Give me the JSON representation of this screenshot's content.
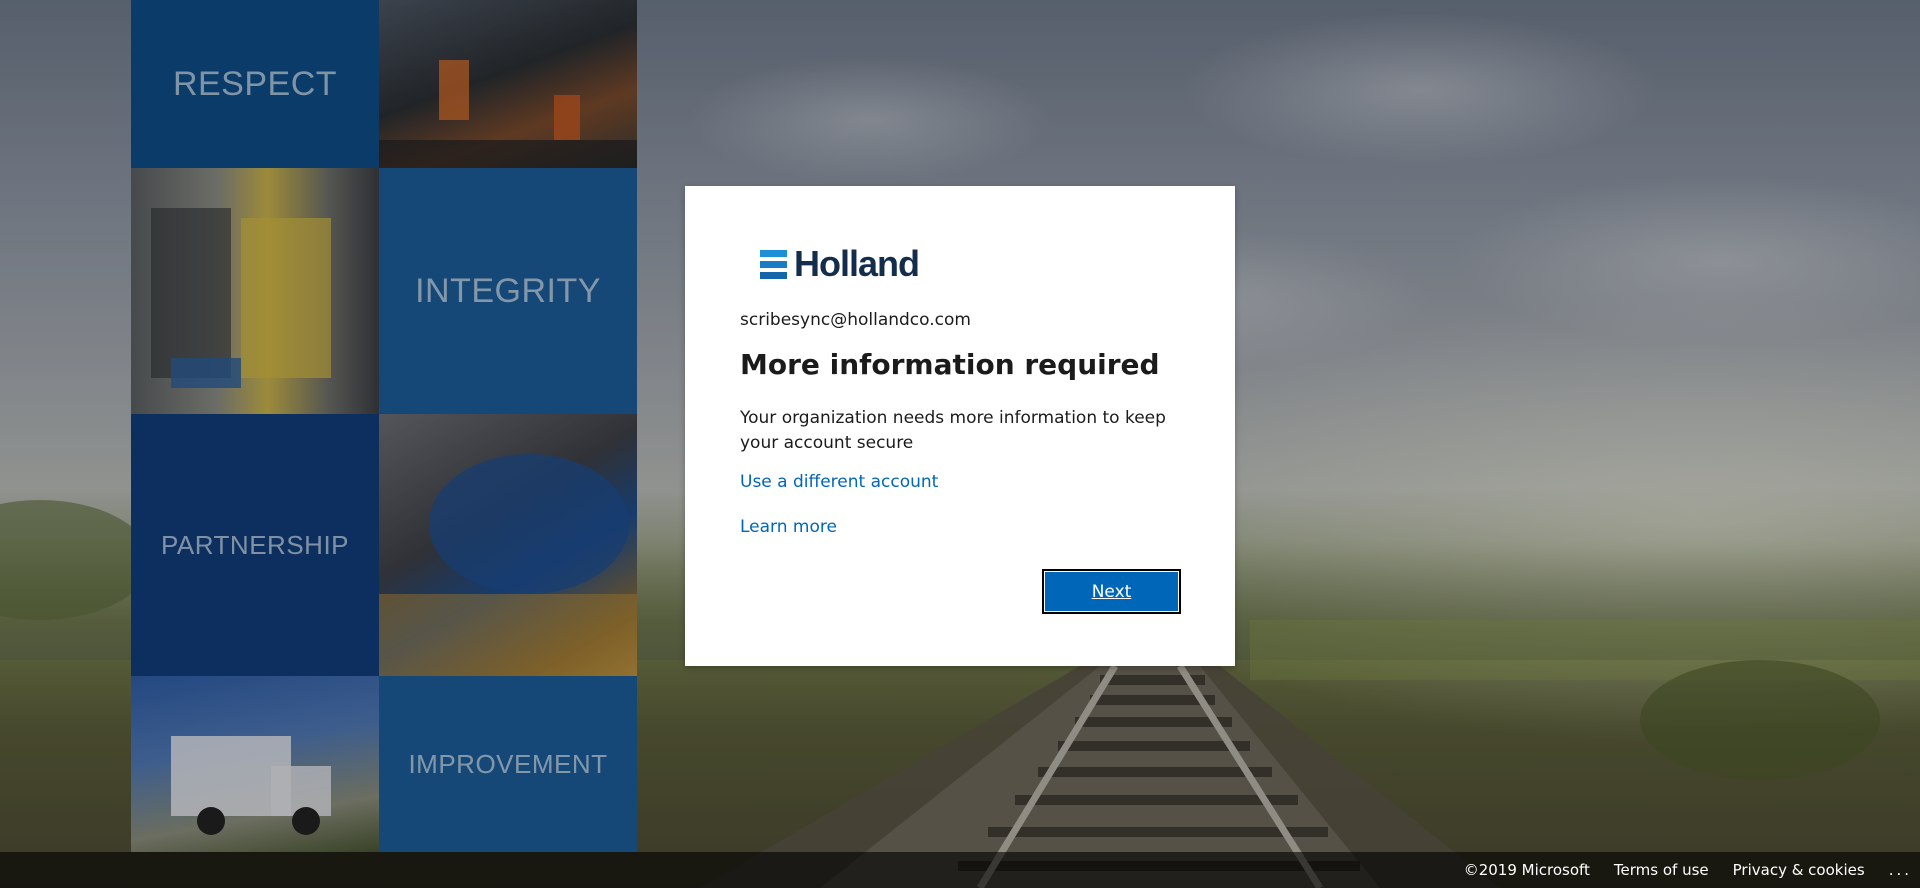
{
  "background": {
    "values_tiles": [
      {
        "label": "RESPECT"
      },
      {
        "label": "INTEGRITY"
      },
      {
        "label": "PARTNERSHIP"
      },
      {
        "label": "IMPROVEMENT"
      }
    ]
  },
  "dialog": {
    "logo": {
      "text": "Holland"
    },
    "identity": "scribesync@hollandco.com",
    "title": "More information required",
    "description": "Your organization needs more information to keep your account secure",
    "use_different_account": "Use a different account",
    "learn_more": "Learn more",
    "next_label": "Next"
  },
  "footer": {
    "copyright": "©2019 Microsoft",
    "terms": "Terms of use",
    "privacy": "Privacy & cookies",
    "more": "..."
  },
  "colors": {
    "accent": "#0067b8",
    "tile_blue": "#0f4c86",
    "logo_navy": "#142d4c"
  }
}
